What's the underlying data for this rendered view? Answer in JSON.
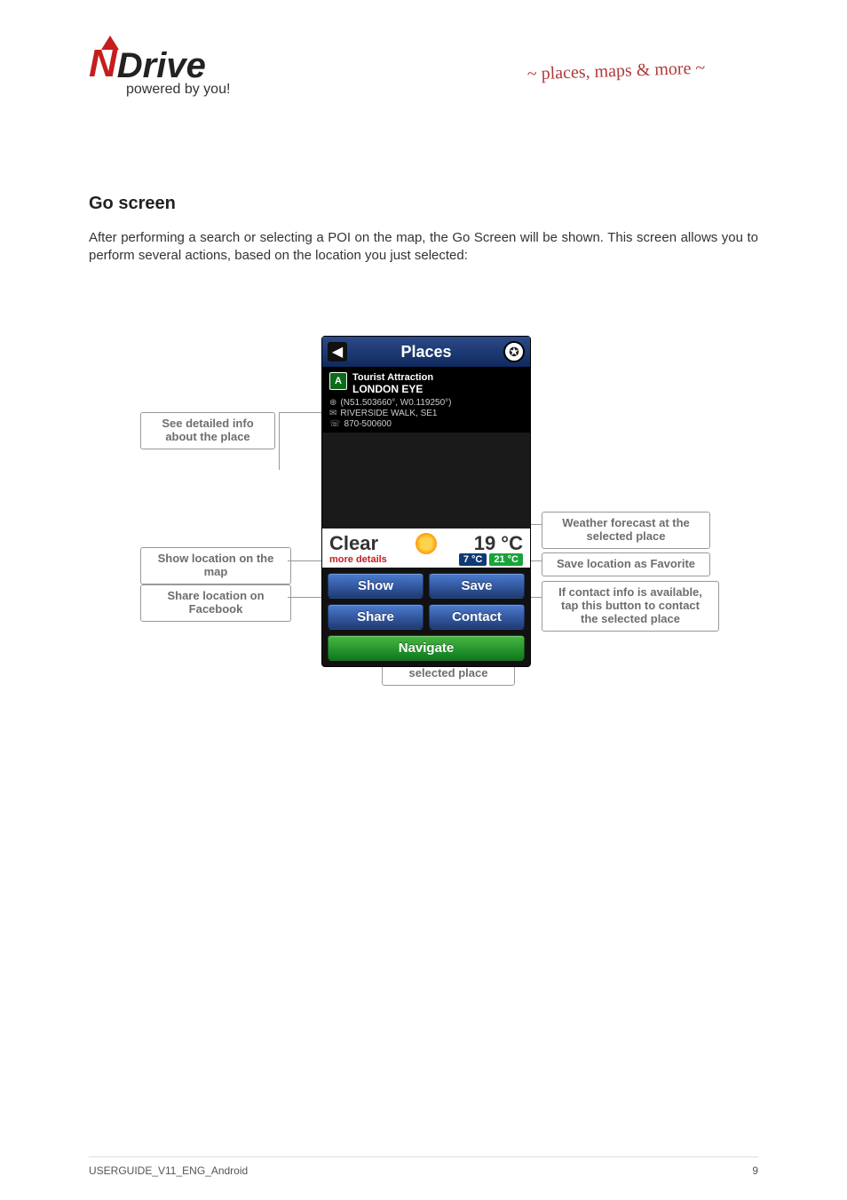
{
  "header": {
    "logo_n": "N",
    "logo_drive": "Drive",
    "logo_sub": "powered by you!",
    "doodle": "~ places, maps & more ~"
  },
  "section_title": "Go screen",
  "body_text": "After performing a search or selecting a POI on the map, the Go Screen will be shown. This screen allows you to perform several actions, based on the location you just selected:",
  "callouts": {
    "detail": "See detailed info\nabout the place",
    "weather": "Weather forecast at the\nselected place",
    "show": "Show location on the\nmap",
    "save": "Save location as Favorite",
    "share": "Share location on\nFacebook",
    "contact": "If contact info is available,\ntap this button to contact\nthe selected place",
    "navigate": "Navigate to the\nselected place"
  },
  "phone": {
    "title": "Places",
    "back_icon": "◀",
    "globe_icon": "✪",
    "poi_category": "Tourist Attraction",
    "poi_name": "LONDON EYE",
    "coords": "(N51.503660°, W0.119250°)",
    "address": "RIVERSIDE WALK, SE1",
    "phone_no": "870-500600",
    "weather": {
      "condition": "Clear",
      "temp": "19 °C",
      "more": "more details",
      "low": "7 °C",
      "high": "21 °C"
    },
    "buttons": {
      "show": "Show",
      "save": "Save",
      "share": "Share",
      "contact": "Contact",
      "navigate": "Navigate"
    }
  },
  "footer": {
    "doc_id": "USERGUIDE_V11_ENG_Android",
    "page_no": "9"
  }
}
